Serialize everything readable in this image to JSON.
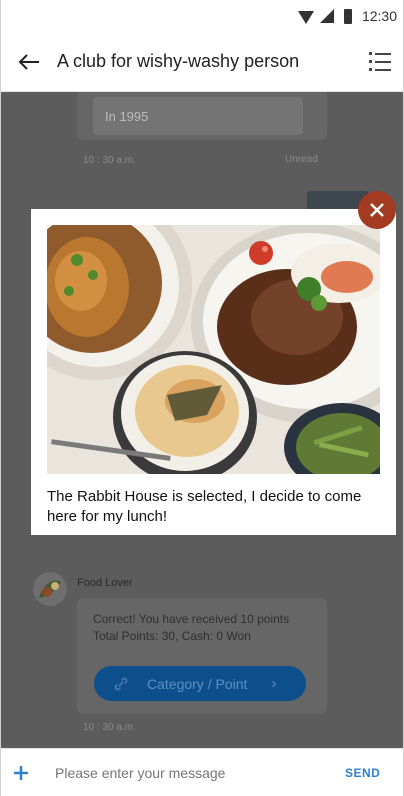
{
  "status_bar": {
    "time": "12:30"
  },
  "app_bar": {
    "title": "A club for wishy-washy person"
  },
  "chat": {
    "previous_message": {
      "answer_text": "In 1995",
      "time": "10 : 30 a.m.",
      "status": "Unread"
    },
    "bot_message": {
      "sender": "Food Lover",
      "line1": "Correct! You have received 10 points",
      "line2": "Total Points: 30, Cash: 0 Won",
      "button_label": "Category / Point",
      "time": "10 : 30 a.m."
    }
  },
  "modal": {
    "caption": "The Rabbit House is selected, I decide to come here for my lunch!"
  },
  "input_bar": {
    "placeholder": "Please enter your message",
    "send_label": "SEND"
  },
  "colors": {
    "accent": "#2f80d1",
    "close_button": "#a33a22",
    "overlay": "#5c5c5c"
  }
}
